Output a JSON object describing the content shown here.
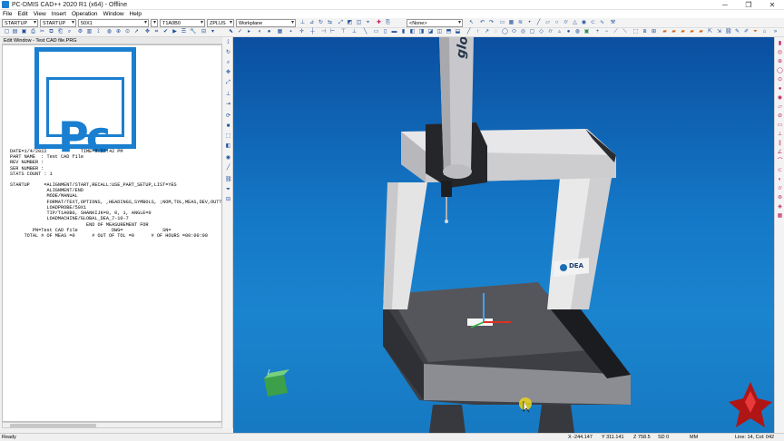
{
  "window": {
    "title": "PC-DMIS CAD++ 2020 R1 (x64) - Offline",
    "controls": [
      "─",
      "❐",
      "✕"
    ]
  },
  "menu": [
    "File",
    "Edit",
    "View",
    "Insert",
    "Operation",
    "Window",
    "Help"
  ],
  "toolbar": {
    "combos": [
      "STARTUP",
      "STARTUP",
      "50X1",
      "",
      "T1A0B0",
      "ZPLUS",
      "Workplane",
      "<None>"
    ]
  },
  "edit_window": {
    "label": "Edit Window - Test CAD file.PRG",
    "logo_text": "Pc",
    "header_lines": [
      "DATE=1/4/2022            TIME=8:52:42 PM",
      "PART NAME  : Test CAD file",
      "REV NUMBER :",
      "SER NUMBER :",
      "STATS COUNT : 1"
    ],
    "program_lines": [
      "STARTUP     =ALIGNMENT/START,RECALL:USE_PART_SETUP,LIST=YES",
      "             ALIGNMENT/END",
      "             MODE/MANUAL",
      "             FORMAT/TEXT,OPTIONS, ,HEADINGS,SYMBOLS, ;NOM,TOL,MEAS,DEV,OUTT",
      "             LOADPROBE/50X1",
      "             TIP/T1A0B0, SHANKIJK=0, 0, 1, ANGLE=0",
      "             LOADMACHINE/GLOBAL_DEA_7-10-7"
    ],
    "footer_lines": [
      "                           END OF MEASUREMENT FOR",
      "        PN=Test CAD file            DWG=              SN=",
      "     TOTAL # OF MEAS =0      # OUT OF TOL =0      # OF HOURS =00:00:00"
    ]
  },
  "viewport": {
    "probe_label": "global",
    "brand_label": "DEA"
  },
  "status": {
    "left": "Ready",
    "x": "X -244.147",
    "y": "Y 311.141",
    "z": "Z 758.5",
    "sd": "SD 0",
    "unit": "MM",
    "linecol": "Line: 14, Col: 042"
  },
  "colors": {
    "viewport_top": "#0b4fa0",
    "viewport_bottom": "#1b84cf",
    "logo_blue": "#1a7fd0",
    "machine_dark": "#3a3b40",
    "machine_light": "#e4e4e4"
  }
}
